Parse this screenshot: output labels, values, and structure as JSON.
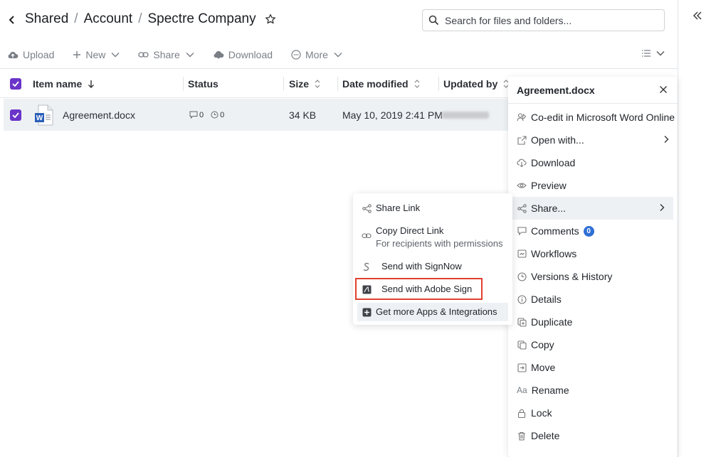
{
  "header": {
    "breadcrumbs": [
      "Shared",
      "Account",
      "Spectre Company"
    ],
    "separator": "/",
    "search_placeholder": "Search for files and folders..."
  },
  "toolbar": {
    "upload": "Upload",
    "new": "New",
    "share": "Share",
    "download": "Download",
    "more": "More"
  },
  "table": {
    "columns": {
      "name": "Item name",
      "status": "Status",
      "size": "Size",
      "date": "Date modified",
      "updated": "Updated by"
    },
    "rows": [
      {
        "name": "Agreement.docx",
        "comments": "0",
        "versions": "0",
        "size": "34 KB",
        "date": "May 10, 2019 2:41 PM",
        "selected": true
      }
    ]
  },
  "context_menu": {
    "title": "Agreement.docx",
    "items": [
      {
        "label": "Co-edit in Microsoft Word Online",
        "icon": "co-edit-icon"
      },
      {
        "label": "Open with...",
        "icon": "external-link-icon",
        "submenu": true
      },
      {
        "label": "Download",
        "icon": "cloud-download-icon"
      },
      {
        "label": "Preview",
        "icon": "eye-icon"
      },
      {
        "label": "Share...",
        "icon": "share-icon",
        "submenu": true,
        "active": true
      },
      {
        "label": "Comments",
        "icon": "comment-icon",
        "badge": "0"
      },
      {
        "label": "Workflows",
        "icon": "workflow-icon"
      },
      {
        "label": "Versions & History",
        "icon": "clock-icon"
      },
      {
        "label": "Details",
        "icon": "info-icon"
      },
      {
        "label": "Duplicate",
        "icon": "duplicate-icon"
      },
      {
        "label": "Copy",
        "icon": "copy-icon"
      },
      {
        "label": "Move",
        "icon": "move-icon"
      },
      {
        "label": "Rename",
        "icon": "rename-icon",
        "icon_text": "Aa"
      },
      {
        "label": "Lock",
        "icon": "lock-icon"
      },
      {
        "label": "Delete",
        "icon": "trash-icon"
      }
    ]
  },
  "share_submenu": {
    "share_link": "Share Link",
    "copy_direct_link": "Copy Direct Link",
    "copy_direct_link_sub": "For recipients with permissions",
    "signnow": "Send with SignNow",
    "adobe_sign": "Send with Adobe Sign",
    "more_apps": "Get more Apps & Integrations"
  },
  "colors": {
    "accent_purple": "#6a34c9",
    "highlight_red": "#e0412f",
    "badge_blue": "#2f6fd6",
    "row_selected": "#eef1f4"
  }
}
